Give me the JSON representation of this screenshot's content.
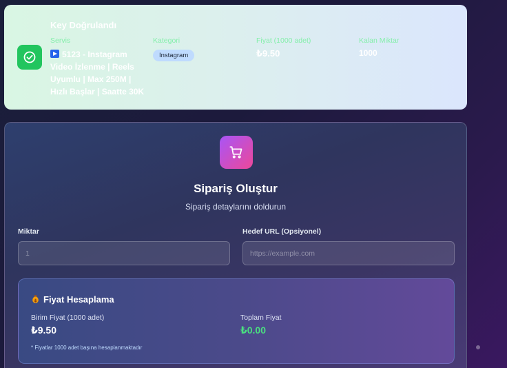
{
  "key_card": {
    "title": "Key Doğrulandı",
    "service_label": "Servis",
    "service_value": "5123 - Instagram Video İzlenme | Reels Uyumlu | Max 250M | Hızlı Başlar | Saatte 30K",
    "category_label": "Kategori",
    "category_value": "Instagram",
    "price_label": "Fiyat (1000 adet)",
    "price_value": "₺9.50",
    "stock_label": "Kalan Miktar",
    "stock_value": "1000",
    "icons": {
      "verified": "check-circle-icon",
      "service": "play-badge-icon"
    },
    "colors": {
      "accent": "#22c55e",
      "label": "#86efac"
    }
  },
  "order_form": {
    "icon": "shopping-cart-icon",
    "title": "Sipariş Oluştur",
    "subtitle": "Sipariş detaylarını doldurun",
    "quantity_label": "Miktar",
    "quantity_placeholder": "1",
    "url_label": "Hedef URL (Opsiyonel)",
    "url_placeholder": "https://example.com"
  },
  "price_calc": {
    "icon": "money-bag-icon",
    "title": "Fiyat Hesaplama",
    "unit_label": "Birim Fiyat (1000 adet)",
    "unit_value": "₺9.50",
    "total_label": "Toplam Fiyat",
    "total_value": "₺0.00",
    "note": "* Fiyatlar 1000 adet başına hesaplanmaktadır",
    "colors": {
      "total": "#4ade80"
    }
  }
}
